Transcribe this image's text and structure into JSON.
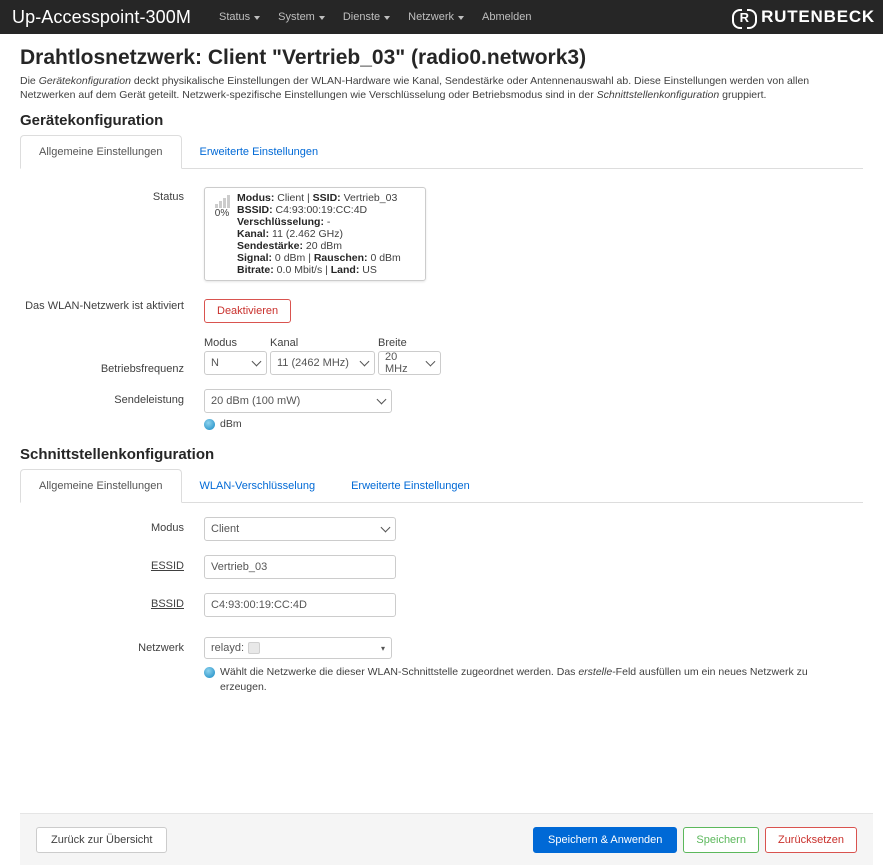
{
  "navbar": {
    "brand": "Up-Accesspoint-300M",
    "menu": [
      {
        "label": "Status",
        "dropdown": true
      },
      {
        "label": "System",
        "dropdown": true
      },
      {
        "label": "Dienste",
        "dropdown": true
      },
      {
        "label": "Netzwerk",
        "dropdown": true
      },
      {
        "label": "Abmelden",
        "dropdown": false
      }
    ],
    "logo_mark": "R",
    "logo_text": "RUTENBECK"
  },
  "page": {
    "title": "Drahtlosnetzwerk: Client \"Vertrieb_03\" (radio0.network3)",
    "desc_1": "Die ",
    "desc_em1": "Gerätekonfiguration",
    "desc_2": " deckt physikalische Einstellungen der WLAN-Hardware wie Kanal, Sendestärke oder Antennenauswahl ab. Diese Einstellungen werden von allen Netzwerken auf dem Gerät geteilt. Netzwerk-spezifische Einstellungen wie Verschlüsselung oder Betriebsmodus sind in der ",
    "desc_em2": "Schnittstellenkonfiguration",
    "desc_3": " gruppiert."
  },
  "device": {
    "heading": "Gerätekonfiguration",
    "tabs": [
      "Allgemeine Einstellungen",
      "Erweiterte Einstellungen"
    ],
    "status_label": "Status",
    "signal_percent": "0%",
    "status": {
      "modus_k": "Modus:",
      "modus_v": " Client | ",
      "ssid_k": "SSID:",
      "ssid_v": " Vertrieb_03",
      "bssid_k": "BSSID:",
      "bssid_v": " C4:93:00:19:CC:4D",
      "enc_k": "Verschlüsselung:",
      "enc_v": " -",
      "kanal_k": "Kanal:",
      "kanal_v": " 11 (2.462 GHz)",
      "send_k": "Sendestärke:",
      "send_v": " 20 dBm",
      "signal_k": "Signal:",
      "signal_v": " 0 dBm | ",
      "noise_k": "Rauschen:",
      "noise_v": " 0 dBm",
      "bitrate_k": "Bitrate:",
      "bitrate_v": " 0.0 Mbit/s | ",
      "land_k": "Land:",
      "land_v": " US"
    },
    "enabled_label": "Das WLAN-Netzwerk ist aktiviert",
    "disable_button": "Deaktivieren",
    "freq_label": "Betriebsfrequenz",
    "freq": {
      "modus_label": "Modus",
      "modus_value": "N",
      "kanal_label": "Kanal",
      "kanal_value": "11 (2462 MHz)",
      "breite_label": "Breite",
      "breite_value": "20 MHz"
    },
    "txpower_label": "Sendeleistung",
    "txpower_value": "20 dBm (100 mW)",
    "txpower_help": "dBm"
  },
  "iface": {
    "heading": "Schnittstellenkonfiguration",
    "tabs": [
      "Allgemeine Einstellungen",
      "WLAN-Verschlüsselung",
      "Erweiterte Einstellungen"
    ],
    "mode_label": "Modus",
    "mode_value": "Client",
    "essid_label": "ESSID",
    "essid_value": "Vertrieb_03",
    "bssid_label": "BSSID",
    "bssid_value": "C4:93:00:19:CC:4D",
    "network_label": "Netzwerk",
    "network_value": "relayd:",
    "help_1": "Wählt die Netzwerke die dieser WLAN-Schnittstelle zugeordnet werden. Das ",
    "help_em": "erstelle",
    "help_2": "-Feld ausfüllen um ein neues Netzwerk zu erzeugen."
  },
  "footer": {
    "back": "Zurück zur Übersicht",
    "save_apply": "Speichern & Anwenden",
    "save": "Speichern",
    "reset": "Zurücksetzen"
  },
  "colors": {
    "navbar": "#262626",
    "link": "#0069d6",
    "primary": "#0069d6",
    "danger": "#d9534f",
    "success": "#5cb85c"
  }
}
